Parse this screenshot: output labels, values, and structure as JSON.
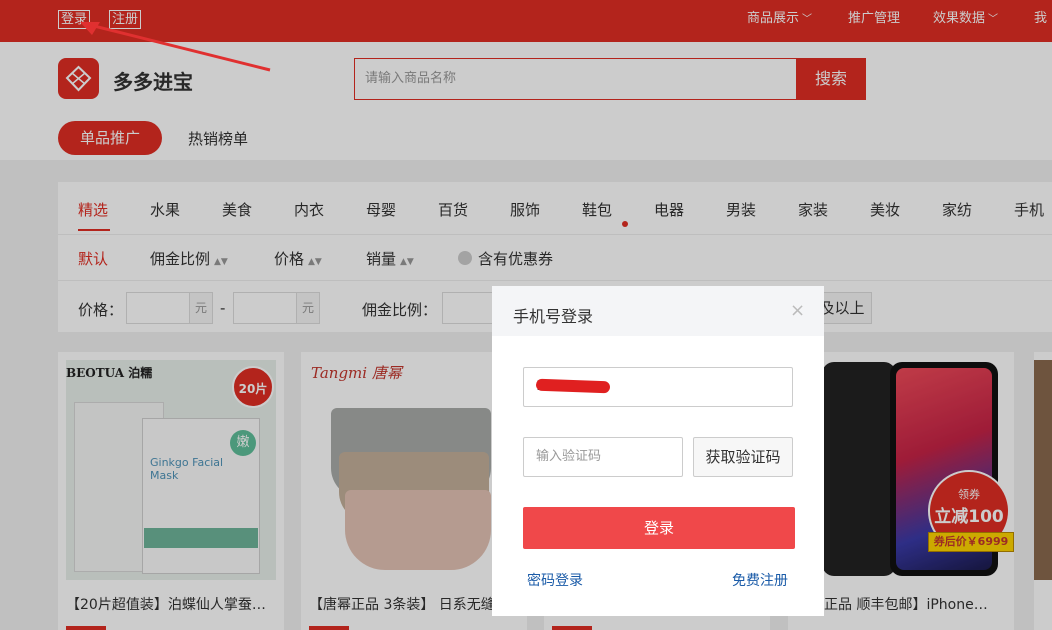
{
  "topbar": {
    "login": "登录",
    "register": "注册",
    "nav": [
      "商品展示",
      "推广管理",
      "效果数据",
      "我"
    ]
  },
  "header": {
    "logo_text": "多多进宝",
    "search_placeholder": "请输入商品名称",
    "search_button": "搜索"
  },
  "tabs": [
    "单品推广",
    "热销榜单"
  ],
  "categories": [
    "精选",
    "水果",
    "美食",
    "内衣",
    "母婴",
    "百货",
    "服饰",
    "鞋包",
    "电器",
    "男装",
    "家装",
    "美妆",
    "家纺",
    "手机"
  ],
  "sort": {
    "items": [
      "默认",
      "佣金比例",
      "价格",
      "销量"
    ],
    "coupon": "含有优惠券"
  },
  "filters": {
    "price_label": "价格：",
    "unit": "元",
    "dash": "-",
    "commission_label": "佣金比例：",
    "commission_suffix": "及以上"
  },
  "products": [
    {
      "title": "【20片超值装】泊蝶仙人掌蚕…",
      "brand": "BEOTUA 泊糯",
      "subtitle": "Ginkgo Facial Mask",
      "badge": "20片",
      "icon_char": "嫩"
    },
    {
      "title": "【唐幂正品 3条装】 日系无缝",
      "brand": "Tangmi 唐幂"
    },
    {
      "title": "",
      "promo_top": "领券",
      "promo_main": "立减100",
      "promo_price": "券后价￥6999"
    },
    {
      "title": "国行正品 顺丰包邮】iPhone…"
    }
  ],
  "modal": {
    "title": "手机号登录",
    "close": "×",
    "phone_value": "13          43",
    "code_placeholder": "输入验证码",
    "get_code": "获取验证码",
    "login_button": "登录",
    "password_login": "密码登录",
    "free_register": "免费注册"
  }
}
